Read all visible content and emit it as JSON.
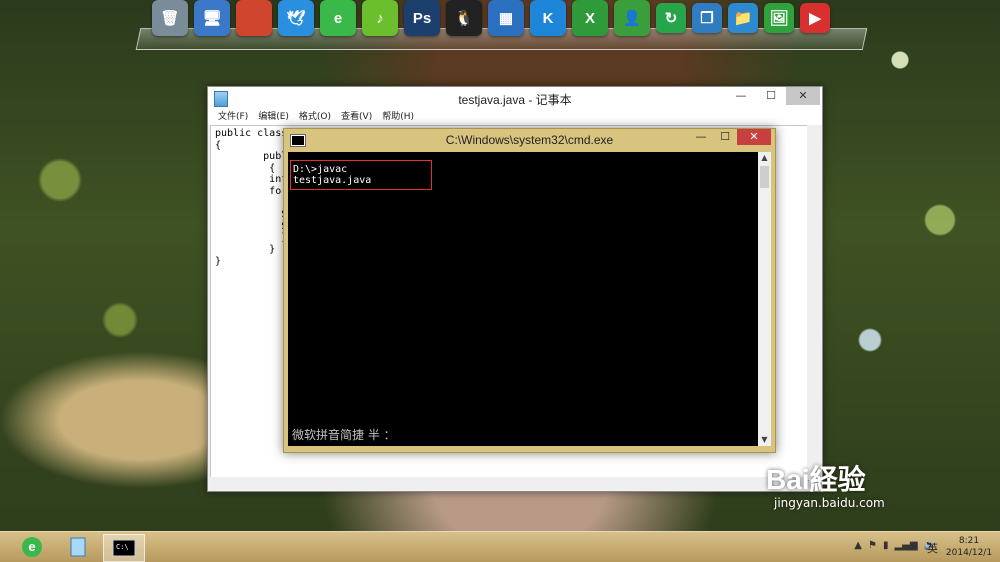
{
  "dock": {
    "icons": [
      {
        "name": "recycle-bin-icon",
        "glyph": "🗑",
        "color": "#7a8c9a"
      },
      {
        "name": "computer-icon",
        "glyph": "🖥",
        "color": "#3c78c8"
      },
      {
        "name": "ccleaner-icon",
        "glyph": "",
        "color": "#d0452e"
      },
      {
        "name": "swallow-bird-icon",
        "glyph": "🕊",
        "color": "#2b8fe0"
      },
      {
        "name": "browser-e-icon",
        "glyph": "e",
        "color": "#3bb84a"
      },
      {
        "name": "music-app-icon",
        "glyph": "♪",
        "color": "#6cbf2c"
      },
      {
        "name": "photoshop-icon",
        "glyph": "Ps",
        "color": "#1c3f6e"
      },
      {
        "name": "qq-icon",
        "glyph": "🐧",
        "color": "#222"
      },
      {
        "name": "film-strip-icon",
        "glyph": "▦",
        "color": "#2b6fc0"
      },
      {
        "name": "kugou-icon",
        "glyph": "K",
        "color": "#1e86d8"
      },
      {
        "name": "excel-icon",
        "glyph": "X",
        "color": "#2e9a3a"
      },
      {
        "name": "contacts-icon",
        "glyph": "👤",
        "color": "#3a9f3a"
      },
      {
        "name": "refresh-icon",
        "glyph": "↻",
        "color": "#27a54a"
      },
      {
        "name": "window-switch-icon",
        "glyph": "❐",
        "color": "#2f7cc0"
      },
      {
        "name": "folder-icon",
        "glyph": "📁",
        "color": "#2b8ad0"
      },
      {
        "name": "picture-icon",
        "glyph": "🖼",
        "color": "#2fa23d"
      },
      {
        "name": "video-player-icon",
        "glyph": "▶",
        "color": "#d8302e"
      }
    ]
  },
  "notepad": {
    "title": "testjava.java - 记事本",
    "menu": [
      "文件(F)",
      "编辑(E)",
      "格式(O)",
      "查看(V)",
      "帮助(H)"
    ],
    "content": "public class\n{\n        publ\n         {\n         int\n         for(\n\n           S\n           S\n           }\n         }\n}"
  },
  "cmd": {
    "title": "C:\\Windows\\system32\\cmd.exe",
    "command_line": "D:\\>javac testjava.java",
    "ime_status": "微软拼音简捷 半 ："
  },
  "taskbar": {
    "language": "英",
    "time": "8:21",
    "date": "2014/12/1"
  },
  "watermark": {
    "brand": "Bai経验",
    "url": "jingyan.baidu.com"
  }
}
